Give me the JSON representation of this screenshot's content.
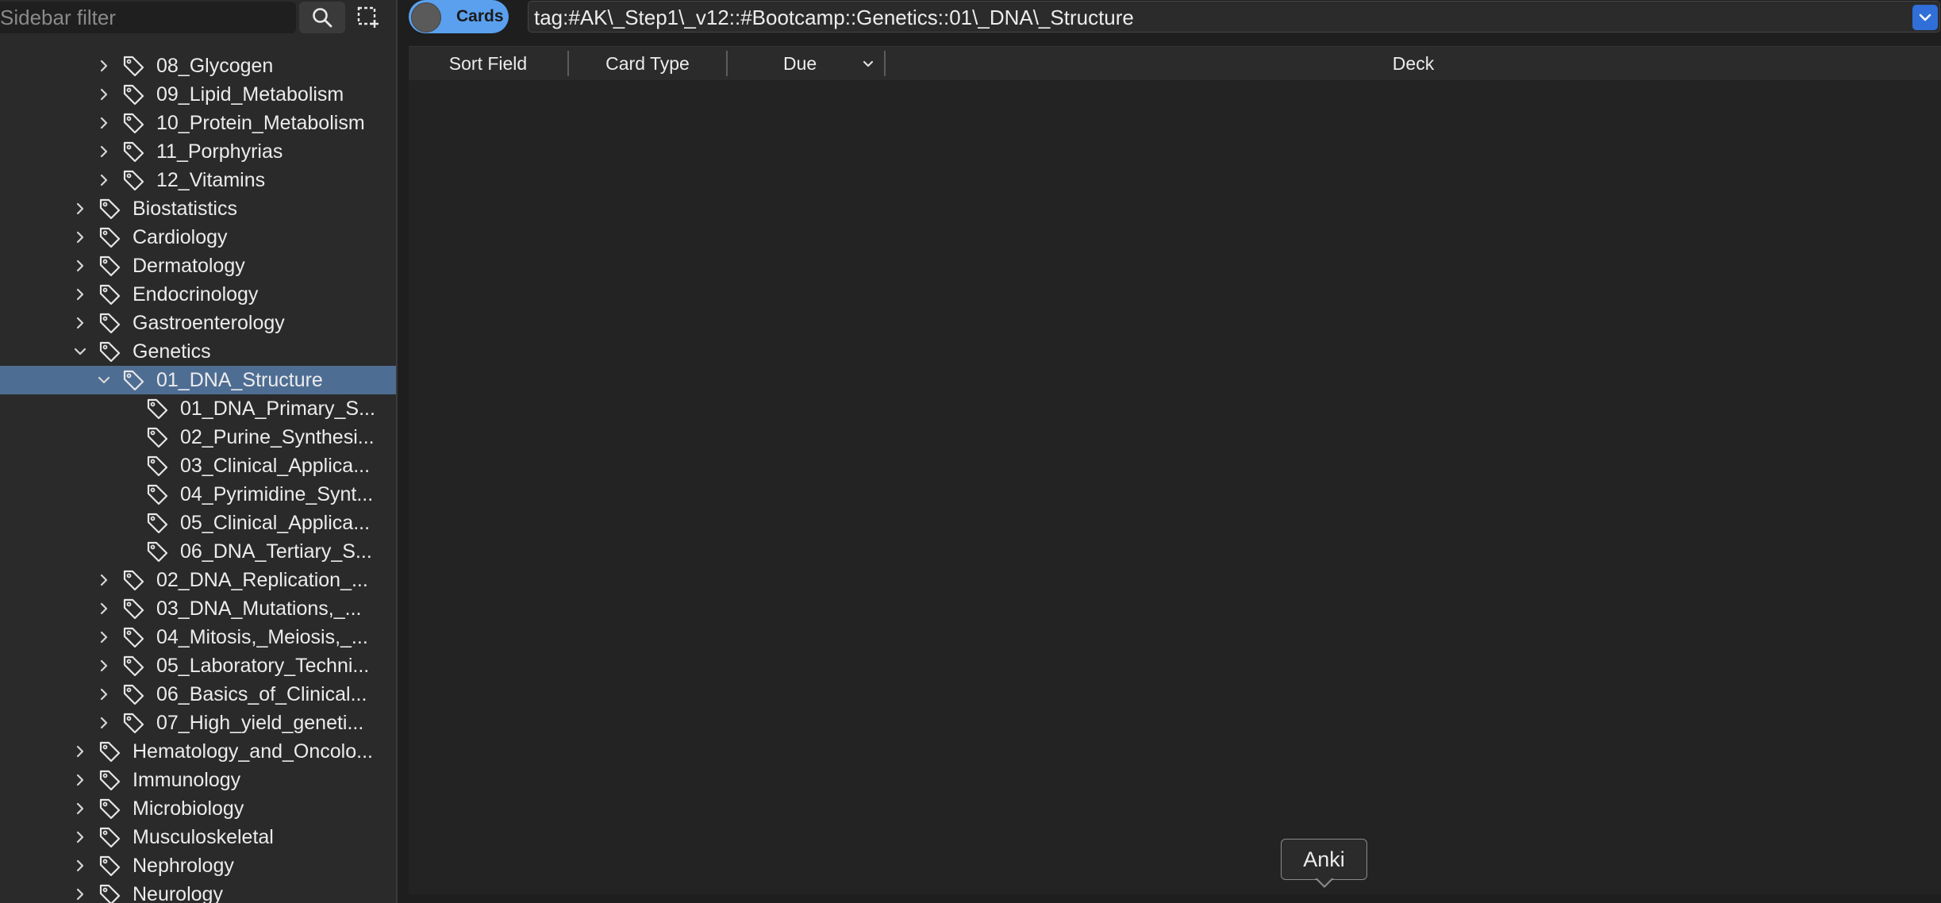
{
  "sidebar": {
    "filter_placeholder": "Sidebar filter",
    "items": [
      {
        "label": "08_Glycogen",
        "level": 2,
        "expandable": true,
        "expanded": false
      },
      {
        "label": "09_Lipid_Metabolism",
        "level": 2,
        "expandable": true,
        "expanded": false
      },
      {
        "label": "10_Protein_Metabolism",
        "level": 2,
        "expandable": true,
        "expanded": false
      },
      {
        "label": "11_Porphyrias",
        "level": 2,
        "expandable": true,
        "expanded": false
      },
      {
        "label": "12_Vitamins",
        "level": 2,
        "expandable": true,
        "expanded": false
      },
      {
        "label": "Biostatistics",
        "level": 1,
        "expandable": true,
        "expanded": false
      },
      {
        "label": "Cardiology",
        "level": 1,
        "expandable": true,
        "expanded": false
      },
      {
        "label": "Dermatology",
        "level": 1,
        "expandable": true,
        "expanded": false
      },
      {
        "label": "Endocrinology",
        "level": 1,
        "expandable": true,
        "expanded": false
      },
      {
        "label": "Gastroenterology",
        "level": 1,
        "expandable": true,
        "expanded": false
      },
      {
        "label": "Genetics",
        "level": 1,
        "expandable": true,
        "expanded": true
      },
      {
        "label": "01_DNA_Structure",
        "level": 2,
        "expandable": true,
        "expanded": true,
        "selected": true
      },
      {
        "label": "01_DNA_Primary_S...",
        "level": 3,
        "expandable": false
      },
      {
        "label": "02_Purine_Synthesi...",
        "level": 3,
        "expandable": false
      },
      {
        "label": "03_Clinical_Applica...",
        "level": 3,
        "expandable": false
      },
      {
        "label": "04_Pyrimidine_Synt...",
        "level": 3,
        "expandable": false
      },
      {
        "label": "05_Clinical_Applica...",
        "level": 3,
        "expandable": false
      },
      {
        "label": "06_DNA_Tertiary_S...",
        "level": 3,
        "expandable": false
      },
      {
        "label": "02_DNA_Replication_...",
        "level": 2,
        "expandable": true,
        "expanded": false
      },
      {
        "label": "03_DNA_Mutations,_...",
        "level": 2,
        "expandable": true,
        "expanded": false
      },
      {
        "label": "04_Mitosis,_Meiosis,_...",
        "level": 2,
        "expandable": true,
        "expanded": false
      },
      {
        "label": "05_Laboratory_Techni...",
        "level": 2,
        "expandable": true,
        "expanded": false
      },
      {
        "label": "06_Basics_of_Clinical...",
        "level": 2,
        "expandable": true,
        "expanded": false
      },
      {
        "label": "07_High_yield_geneti...",
        "level": 2,
        "expandable": true,
        "expanded": false
      },
      {
        "label": "Hematology_and_Oncolo...",
        "level": 1,
        "expandable": true,
        "expanded": false
      },
      {
        "label": "Immunology",
        "level": 1,
        "expandable": true,
        "expanded": false
      },
      {
        "label": "Microbiology",
        "level": 1,
        "expandable": true,
        "expanded": false
      },
      {
        "label": "Musculoskeletal",
        "level": 1,
        "expandable": true,
        "expanded": false
      },
      {
        "label": "Nephrology",
        "level": 1,
        "expandable": true,
        "expanded": false
      },
      {
        "label": "Neurology",
        "level": 1,
        "expandable": true,
        "expanded": false
      }
    ]
  },
  "toolbar": {
    "mode_label": "Cards",
    "search_query": "tag:#AK\\_Step1\\_v12::#Bootcamp::Genetics::01\\_DNA\\_Structure"
  },
  "table": {
    "columns": [
      "Sort Field",
      "Card Type",
      "Due",
      "Deck"
    ]
  },
  "tooltip": {
    "text": "Anki"
  },
  "colors": {
    "selection": "#4e6d93",
    "accent": "#5aa0ee",
    "combo_button": "#2f6fd7"
  }
}
